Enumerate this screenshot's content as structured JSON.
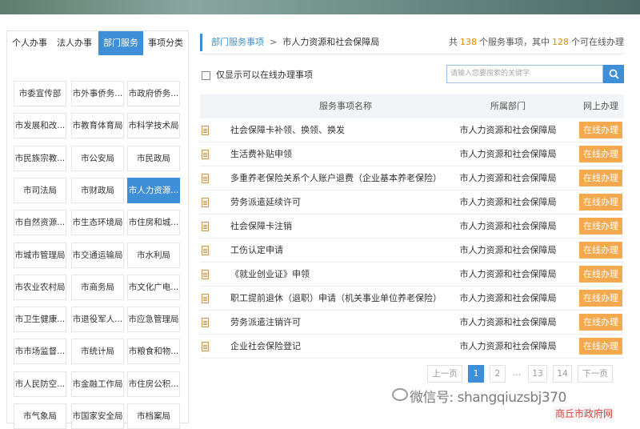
{
  "tabs": [
    "个人办事",
    "法人办事",
    "部门服务",
    "事项分类"
  ],
  "active_tab": 2,
  "departments": [
    "市委宣传部",
    "市外事侨务...",
    "市政府侨务...",
    "市发展和改...",
    "市教育体育局",
    "市科学技术局",
    "市民族宗教...",
    "市公安局",
    "市民政局",
    "市司法局",
    "市财政局",
    "市人力资源...",
    "市自然资源...",
    "市生态环境局",
    "市住房和城...",
    "市城市管理局",
    "市交通运输局",
    "市水利局",
    "市农业农村局",
    "市商务局",
    "市文化广电...",
    "市卫生健康...",
    "市退役军人...",
    "市应急管理局",
    "市市场监督...",
    "市统计局",
    "市粮食和物...",
    "市人民防空...",
    "市金融工作局",
    "市住房公积...",
    "市气象局",
    "市国家安全局",
    "市档案局"
  ],
  "active_department": 11,
  "breadcrumb": {
    "root": "部门服务事项",
    "separator": ">",
    "current": "市人力资源和社会保障局"
  },
  "summary": {
    "prefix": "共",
    "total": "138",
    "mid": "个服务事项，其中",
    "online": "128",
    "suffix": "个可在线办理"
  },
  "filter_label": "仅显示可以在线办理事项",
  "search_placeholder": "请输入您要搜索的关键字",
  "table": {
    "headers": [
      "服务事项名称",
      "所属部门",
      "网上办理"
    ],
    "rows": [
      {
        "name": "社会保障卡补领、换领、换发",
        "dept": "市人力资源和社会保障局",
        "action": "在线办理"
      },
      {
        "name": "生活费补贴申领",
        "dept": "市人力资源和社会保障局",
        "action": "在线办理"
      },
      {
        "name": "多重养老保险关系个人账户退费（企业基本养老保险）",
        "dept": "市人力资源和社会保障局",
        "action": "在线办理"
      },
      {
        "name": "劳务派遣延续许可",
        "dept": "市人力资源和社会保障局",
        "action": "在线办理"
      },
      {
        "name": "社会保障卡注销",
        "dept": "市人力资源和社会保障局",
        "action": "在线办理"
      },
      {
        "name": "工伤认定申请",
        "dept": "市人力资源和社会保障局",
        "action": "在线办理"
      },
      {
        "name": "《就业创业证》申领",
        "dept": "市人力资源和社会保障局",
        "action": "在线办理"
      },
      {
        "name": "职工提前退休（退职）申请（机关事业单位养老保险）",
        "dept": "市人力资源和社会保障局",
        "action": "在线办理"
      },
      {
        "name": "劳务派遣注销许可",
        "dept": "市人力资源和社会保障局",
        "action": "在线办理"
      },
      {
        "name": "企业社会保险登记",
        "dept": "市人力资源和社会保障局",
        "action": "在线办理"
      }
    ]
  },
  "pager": {
    "prev": "上一页",
    "pages": [
      "1",
      "2",
      "...",
      "13",
      "14"
    ],
    "current": "1",
    "next": "下一页"
  },
  "watermark": "微信号: shangqiuzsbj370",
  "site_label": "商丘市政府网",
  "colors": {
    "primary": "#3f8fd8",
    "online_button": "#f5a94f",
    "count_number": "#e08a00"
  }
}
